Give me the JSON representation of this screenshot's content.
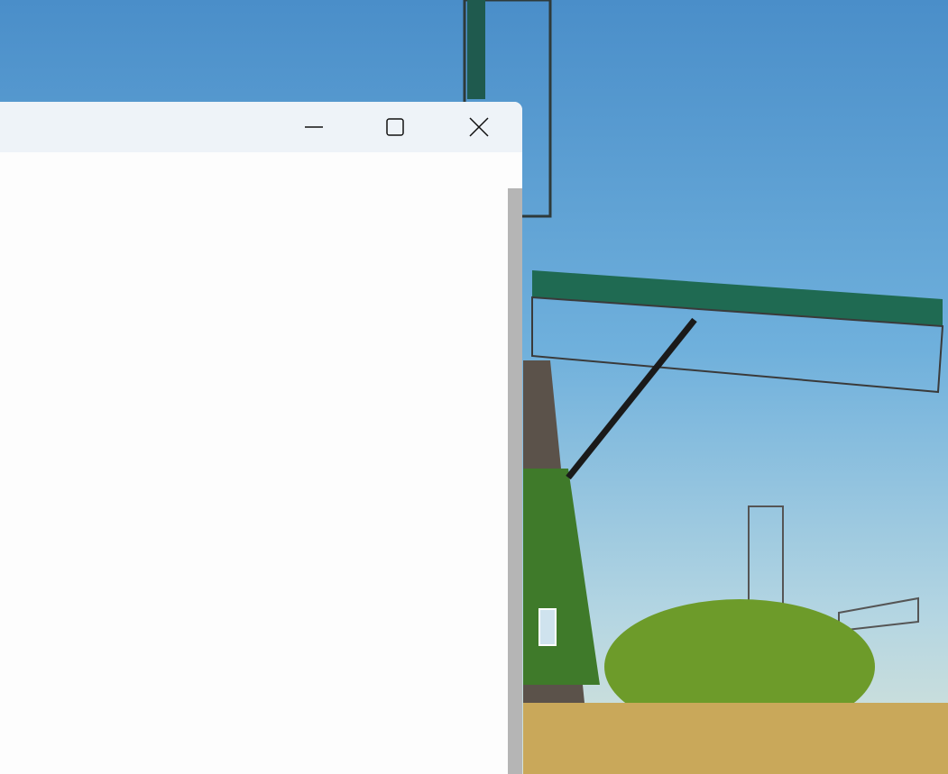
{
  "window": {
    "controls": {
      "minimize": "minimize-icon",
      "maximize": "maximize-icon",
      "close": "close-icon"
    },
    "colors": {
      "titlebar": "#eef3f8",
      "content": "#fdfdfd",
      "scrollbar": "#b5b5b5"
    }
  },
  "desktop": {
    "wallpaper": "windmills-landscape"
  }
}
